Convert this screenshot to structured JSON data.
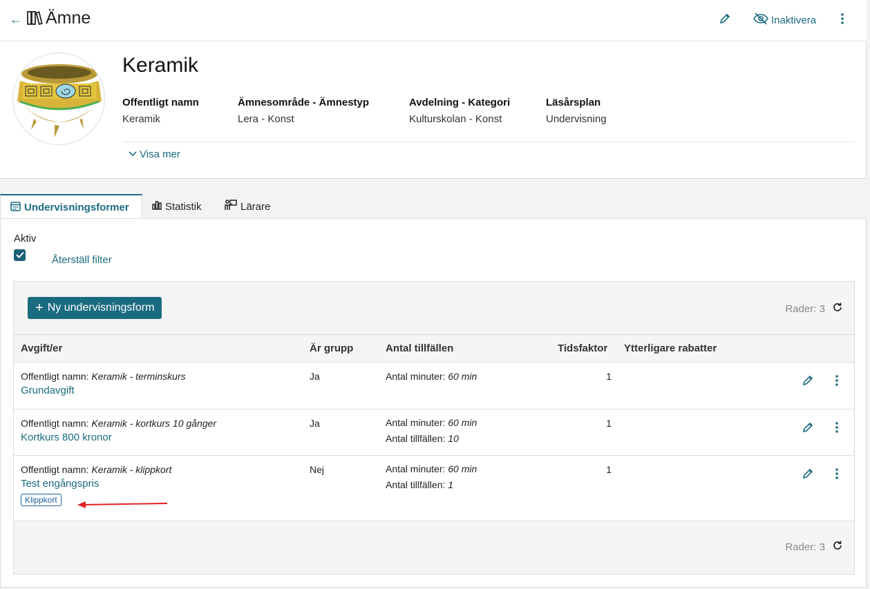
{
  "header": {
    "back_icon": "arrow-left-icon",
    "title_icon": "books-icon",
    "title": "Ämne",
    "edit_icon": "pencil-icon",
    "inactivate_label": "Inaktivera",
    "more_icon": "kebab-icon"
  },
  "subject": {
    "name": "Keramik",
    "fields": [
      {
        "label": "Offentligt namn",
        "value": "Keramik"
      },
      {
        "label": "Ämnesområde - Ämnestyp",
        "value": "Lera - Konst"
      },
      {
        "label": "Avdelning - Kategori",
        "value": "Kulturskolan - Konst"
      },
      {
        "label": "Läsårsplan",
        "value": "Undervisning"
      }
    ],
    "show_more": "Visa mer"
  },
  "tabs": [
    {
      "label": "Undervisningsformer",
      "icon": "calendar-icon",
      "active": true
    },
    {
      "label": "Statistik",
      "icon": "bar-chart-icon",
      "active": false
    },
    {
      "label": "Lärare",
      "icon": "teacher-icon",
      "active": false
    }
  ],
  "filter": {
    "active_label": "Aktiv",
    "active_checked": true,
    "reset_label": "Återställ filter"
  },
  "grid": {
    "new_button": "Ny undervisningsform",
    "rows_label_top": "Rader: 3",
    "rows_label_bottom": "Rader: 3",
    "columns": [
      "Avgift/er",
      "Är grupp",
      "Antal tillfällen",
      "Tidsfaktor",
      "Ytterligare rabatter"
    ],
    "rows": [
      {
        "public_prefix": "Offentligt namn:",
        "public_name": "Keramik - terminskurs",
        "fee": "Grundavgift",
        "badge": "",
        "group": "Ja",
        "minutes_label": "Antal minuter:",
        "minutes": "60 min",
        "occasions_label": "",
        "occasions": "",
        "time_factor": "1"
      },
      {
        "public_prefix": "Offentligt namn:",
        "public_name": "Keramik - kortkurs 10 gånger",
        "fee": "Kortkurs 800 kronor",
        "badge": "",
        "group": "Ja",
        "minutes_label": "Antal minuter:",
        "minutes": "60 min",
        "occasions_label": "Antal tillfällen:",
        "occasions": "10",
        "time_factor": "1"
      },
      {
        "public_prefix": "Offentligt namn:",
        "public_name": "Keramik - klippkort",
        "fee": "Test engångspris",
        "badge": "Klippkort",
        "group": "Nej",
        "minutes_label": "Antal minuter:",
        "minutes": "60 min",
        "occasions_label": "Antal tillfällen:",
        "occasions": "1",
        "time_factor": "1"
      }
    ]
  },
  "colors": {
    "accent": "#1b6b80",
    "annotation_arrow": "#e02020"
  }
}
